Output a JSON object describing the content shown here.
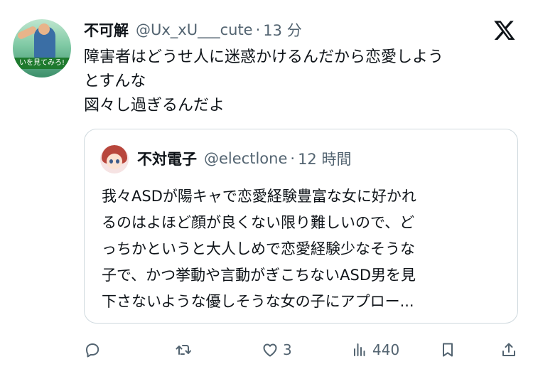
{
  "tweet": {
    "author_name": "不可解",
    "author_handle": "@Ux_xU___cute",
    "separator": "·",
    "time": "13 分",
    "avatar_caption": "いを見てみろ!",
    "text_lines": [
      "障害者はどうせ人に迷惑かけるんだから恋愛しよう",
      "とすんな",
      "図々し過ぎるんだよ"
    ]
  },
  "quoted": {
    "author_name": "不対電子",
    "author_handle": "@electlone",
    "separator": "·",
    "time": "12 時間",
    "text_lines": [
      "我々ASDが陽キャで恋愛経験豊富な女に好かれ",
      "るのはよほど顔が良くない限り難しいので、ど",
      "っちかというと大人しめで恋愛経験少なそうな",
      "子で、かつ挙動や言動がぎこちないASD男を見",
      "下さないような優しそうな女の子にアプロー..."
    ]
  },
  "actions": {
    "reply_count": "",
    "retweet_count": "",
    "like_count": "3",
    "view_count": "440"
  },
  "icons": {
    "platform": "x-logo-icon",
    "reply": "reply-icon",
    "retweet": "retweet-icon",
    "like": "heart-icon",
    "views": "views-icon",
    "bookmark": "bookmark-icon",
    "share": "share-icon"
  },
  "colors": {
    "text": "#0f1419",
    "secondary": "#536471",
    "border": "#cfd9de"
  }
}
